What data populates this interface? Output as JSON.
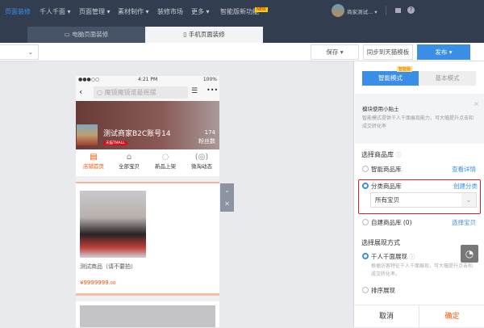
{
  "topnav": {
    "brand": "页面装修",
    "items": [
      "千人千面 ▾",
      "页面管理 ▾",
      "素材制作 ▾",
      "装修市场",
      "更多 ▾",
      "智能版新功能"
    ],
    "new_badge": "NEW",
    "user": "商家测试... ▾"
  },
  "tabs": [
    {
      "label": "电脑页面装修",
      "active": false
    },
    {
      "label": "手机页面装修",
      "active": true
    }
  ],
  "toolbar": {
    "save": "保存 ▾",
    "sync": "同步到天猫模板",
    "publish": "发布 ▾",
    "accent": "#3a8ee6"
  },
  "phone": {
    "status": {
      "signal": "●●●○○",
      "time": "4:21 PM",
      "battery": "100%"
    },
    "search_placeholder": "魔镜魔镜谁最摇摆",
    "shop_name": "测试商家B2C账号14",
    "tmall_badge": "天猫TMALL",
    "fans_count": "174",
    "fans_label": "粉丝数",
    "nav": [
      {
        "label": "店铺首页",
        "active": true
      },
      {
        "label": "全部宝贝"
      },
      {
        "label": "新品上架"
      },
      {
        "label": "微淘动态"
      }
    ],
    "product": {
      "title": "测试商品（请不要拍）",
      "price": "¥9999999",
      "price_decimal": ".00"
    }
  },
  "panel": {
    "mode_badge": "智能版",
    "mode_smart": "智能模式",
    "mode_basic": "基本模式",
    "tip_title": "模块使用小贴士",
    "tip_text": "智能模式提供千人千面展现能力，可大幅提升点击和成交转化率",
    "library_label": "选择商品库",
    "options": [
      {
        "label": "智能商品库",
        "link": "查看详情",
        "selected": false
      },
      {
        "label": "分类商品库",
        "link": "创建分类",
        "selected": true
      },
      {
        "label": "自建商品库 (0)",
        "link": "选择宝贝",
        "selected": false
      }
    ],
    "category_select": "所有宝贝",
    "display_label": "选择展现方式",
    "display_options": [
      {
        "label": "千人千面展现",
        "selected": true,
        "desc": "根据访客特征千人千面展现，可大幅提升点击和成交转化率。"
      },
      {
        "label": "排序展现",
        "selected": false
      }
    ],
    "cancel": "取消",
    "confirm": "确定",
    "confirm_color": "#ff5000"
  }
}
